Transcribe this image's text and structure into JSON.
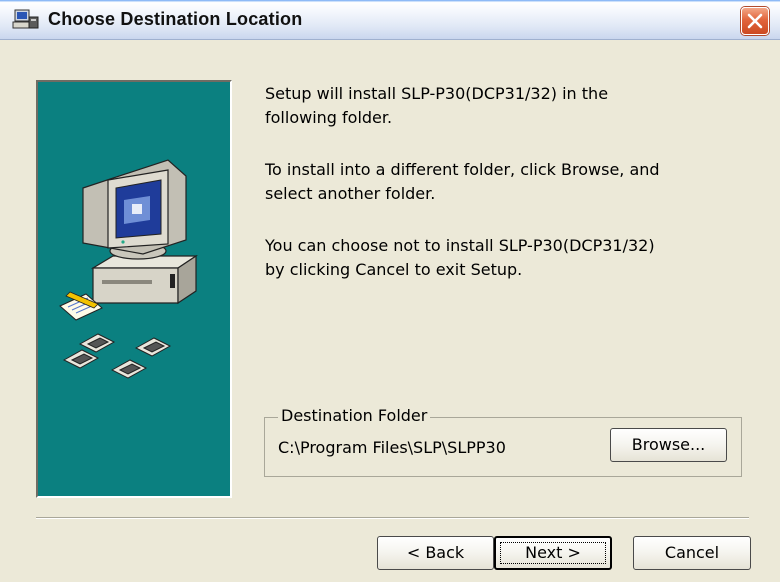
{
  "window": {
    "title": "Choose Destination Location",
    "title_icon": "installer-icon",
    "close_icon": "close-icon"
  },
  "side_panel": {
    "illustration": "computer-with-disks-illustration",
    "background_color": "#0b8080"
  },
  "message": {
    "line1": "Setup will install SLP-P30(DCP31/32) in the\nfollowing folder.",
    "line2": "To install into a different folder, click Browse, and\nselect another folder.",
    "line3": "You can choose not to install SLP-P30(DCP31/32)\nby clicking Cancel to exit Setup."
  },
  "destination": {
    "group_label": "Destination Folder",
    "path": "C:\\Program Files\\SLP\\SLPP30",
    "browse_label": "Browse..."
  },
  "buttons": {
    "back_label": "< Back",
    "next_label": "Next >",
    "cancel_label": "Cancel"
  }
}
